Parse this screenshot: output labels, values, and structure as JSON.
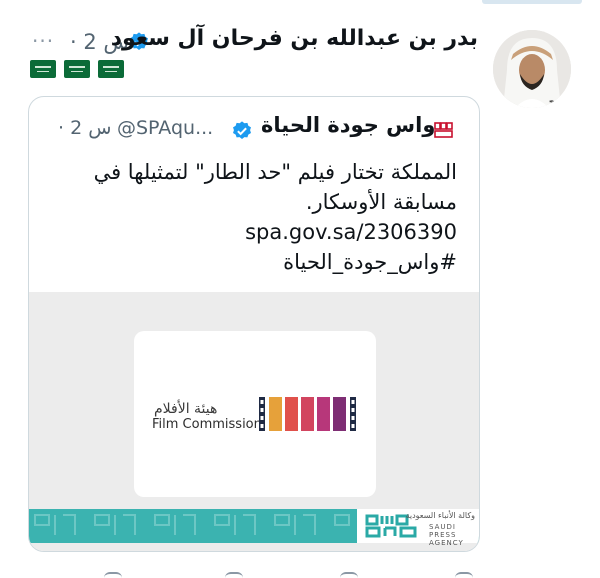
{
  "tweet": {
    "author_name": "بدر بن عبدالله بن فرحان آل سعود",
    "time": "· 2 س",
    "more": "···",
    "flags": [
      "saudi-flag",
      "saudi-flag",
      "saudi-flag"
    ]
  },
  "quote": {
    "author_name": "واس جودة الحياة",
    "handle": "@SPAqu...",
    "time": "· 2 س",
    "text_line1": "المملكة تختار فيلم \"حد الطار\" لتمثيلها في",
    "text_line2": "مسابقة الأوسكار.",
    "link": "spa.gov.sa/2306390",
    "hashtag": "#واس_جودة_الحياة",
    "media": {
      "logo_ar": "هيئة الأفلام",
      "logo_en": "Film Commission",
      "banner_ar": "وكالة الأنباء السعودية",
      "banner_en": "SAUDI PRESS AGENCY"
    }
  },
  "colors": {
    "verified": "#1d9bf0",
    "muted": "#536471",
    "banner": "#3bb3b0",
    "spa_red": "#c8102e",
    "film_strip": [
      "#e6a13a",
      "#e0514b",
      "#d2455f",
      "#b7377a",
      "#7e2e74"
    ]
  }
}
